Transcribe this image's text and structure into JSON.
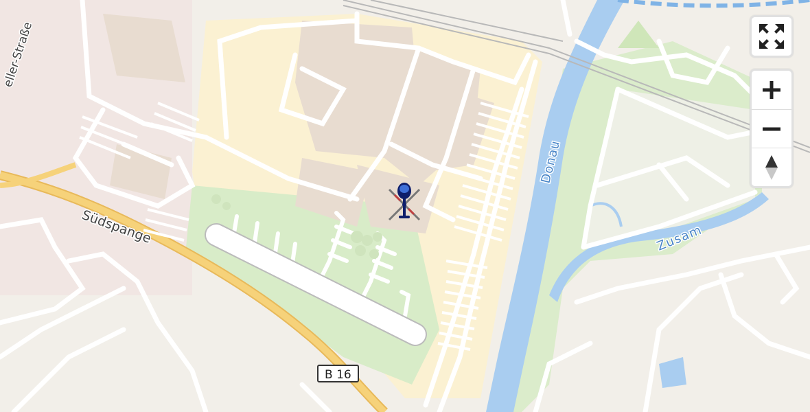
{
  "map": {
    "labels": {
      "river_donau": "Donau",
      "river_zusam": "Zusam",
      "road_suedspange": "Südspange",
      "road_partial": "eller-Straße",
      "road_shield": "B 16"
    },
    "marker": {
      "type": "helicopter",
      "icon": "helicopter-icon"
    }
  },
  "controls": {
    "fullscreen_icon": "fullscreen-icon",
    "zoom_in_icon": "plus-icon",
    "zoom_out_icon": "minus-icon",
    "compass_icon": "compass-icon"
  },
  "colors": {
    "background": "#f2efe9",
    "water": "#a9cdf0",
    "green": "#d8ecc8",
    "industrial": "#fbf1d2",
    "roads": "#ffffff",
    "highway": "#f6d27a",
    "railway": "#c0c0c0",
    "marker": "#0e1e6b"
  }
}
